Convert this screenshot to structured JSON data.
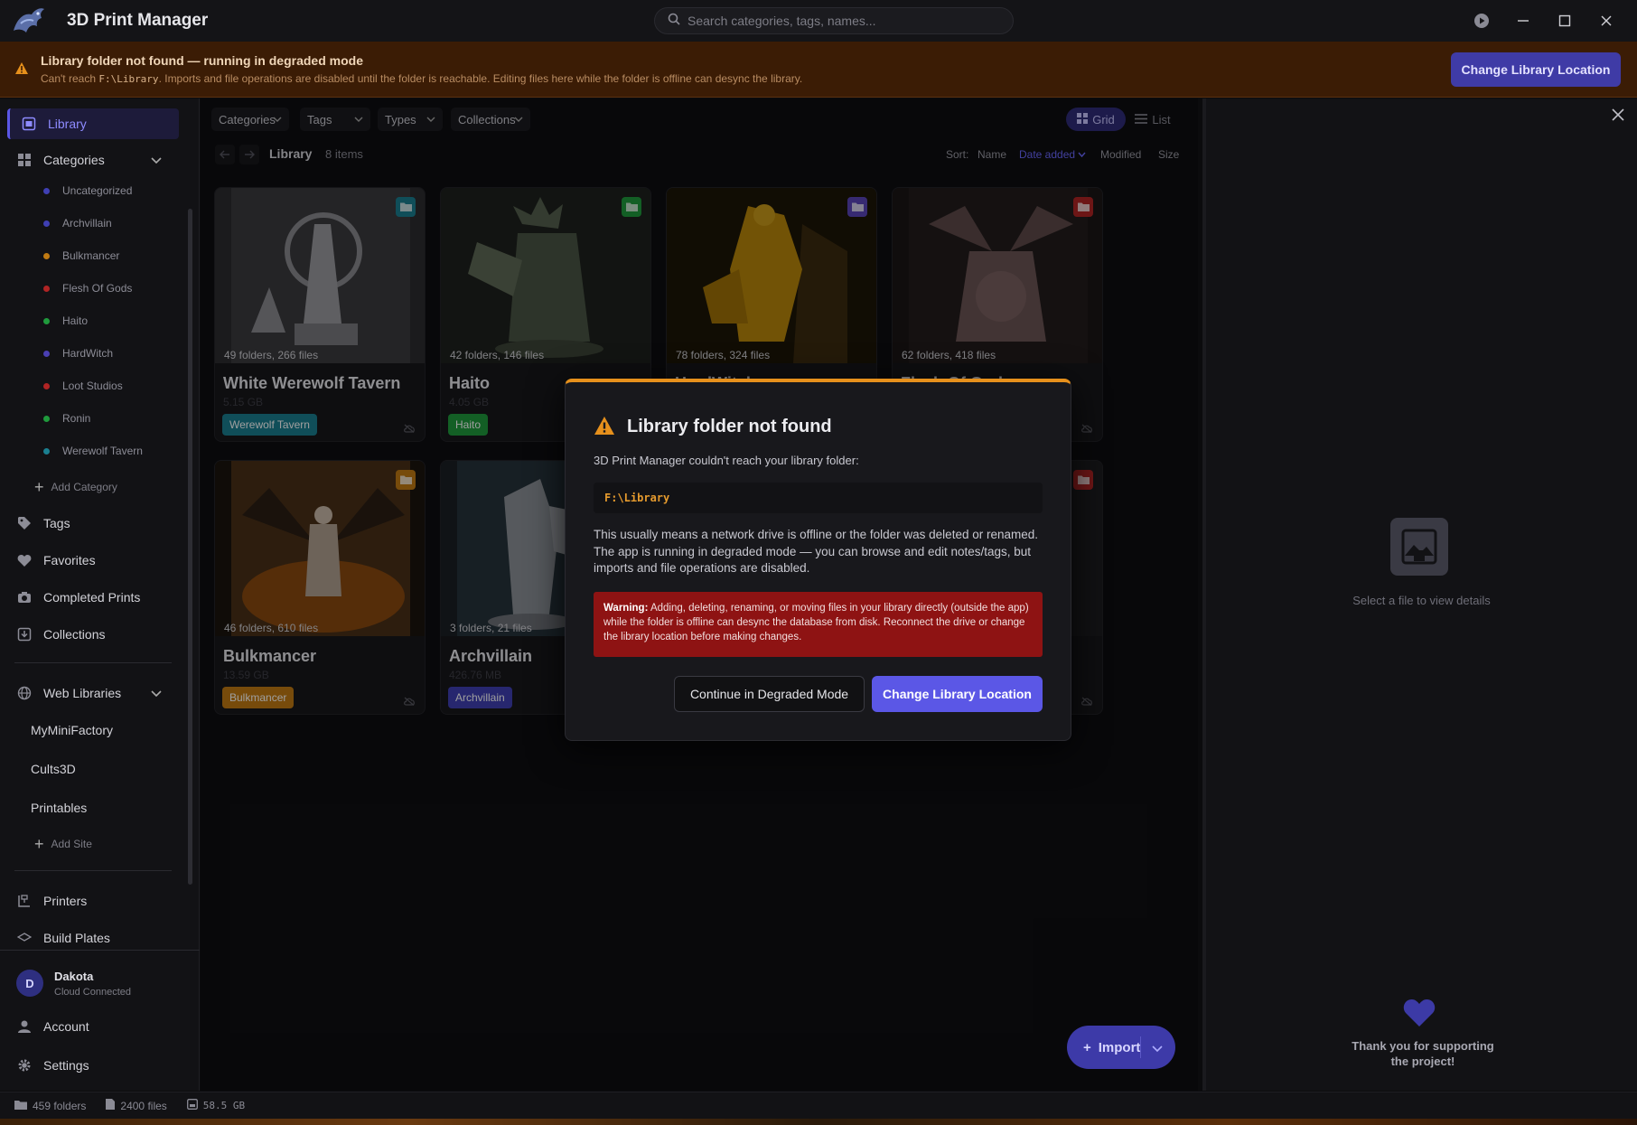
{
  "app": {
    "title": "3D Print Manager"
  },
  "search": {
    "placeholder": "Search categories, tags, names..."
  },
  "banner": {
    "title": "Library folder not found — running in degraded mode",
    "text_before": "Can't reach ",
    "path": "F:\\Library",
    "text_after": ". Imports and file operations are disabled until the folder is reachable. Editing files here while the folder is offline can desync the library.",
    "button": "Change Library Location"
  },
  "sidebar": {
    "library": "Library",
    "categories_label": "Categories",
    "categories": [
      {
        "label": "Uncategorized",
        "color": "#3f3fb3"
      },
      {
        "label": "Archvillain",
        "color": "#3f3fb3"
      },
      {
        "label": "Bulkmancer",
        "color": "#c07a12"
      },
      {
        "label": "Flesh Of Gods",
        "color": "#b02424"
      },
      {
        "label": "Haito",
        "color": "#1f9a3c"
      },
      {
        "label": "HardWitch",
        "color": "#4a3fb3"
      },
      {
        "label": "Loot Studios",
        "color": "#b02424"
      },
      {
        "label": "Ronin",
        "color": "#1f9a3c"
      },
      {
        "label": "Werewolf Tavern",
        "color": "#1a7f90"
      }
    ],
    "add_category": "Add Category",
    "tags": "Tags",
    "favorites": "Favorites",
    "completed_prints": "Completed Prints",
    "collections": "Collections",
    "web_libraries": "Web Libraries",
    "web_sites": [
      "MyMiniFactory",
      "Cults3D",
      "Printables"
    ],
    "add_site": "Add Site",
    "printers": "Printers",
    "build_plates": "Build Plates",
    "user": {
      "initial": "D",
      "name": "Dakota",
      "status": "Cloud Connected"
    },
    "account": "Account",
    "settings": "Settings"
  },
  "toolbar": {
    "filters": [
      "Categories",
      "Tags",
      "Types",
      "Collections"
    ],
    "grid": "Grid",
    "list": "List",
    "breadcrumb": "Library",
    "item_count": "8 items",
    "sort_label": "Sort:",
    "sort_options": [
      "Name",
      "Date added",
      "Modified",
      "Size"
    ],
    "sort_active": "Date added"
  },
  "cards": [
    {
      "title": "White Werewolf Tavern",
      "meta": "49 folders, 266 files",
      "size": "5.15 GB",
      "tag": "Werewolf Tavern",
      "tag_color": "#1a7f90",
      "badge_color": "#1a7f90"
    },
    {
      "title": "Haito",
      "meta": "42 folders, 146 files",
      "size": "4.05 GB",
      "tag": "Haito",
      "tag_color": "#1f9a3c",
      "badge_color": "#1f9a3c"
    },
    {
      "title": "HardWitch",
      "meta": "78 folders, 324 files",
      "size": "",
      "tag": "",
      "tag_color": "#4a3fb3",
      "badge_color": "#5a45b8"
    },
    {
      "title": "Flesh Of Gods",
      "meta": "62 folders, 418 files",
      "size": "",
      "tag": "",
      "tag_color": "#b02424",
      "badge_color": "#b02424"
    },
    {
      "title": "Bulkmancer",
      "meta": "46 folders, 610 files",
      "size": "13.59 GB",
      "tag": "Bulkmancer",
      "tag_color": "#c07a12",
      "badge_color": "#c07a12"
    },
    {
      "title": "Archvillain",
      "meta": "3 folders, 21 files",
      "size": "426.76 MB",
      "tag": "Archvillain",
      "tag_color": "#3f3fb3",
      "badge_color": "#3f3fb3"
    },
    {
      "title": "",
      "meta": "",
      "size": "",
      "tag": "",
      "tag_color": "#b02424",
      "badge_color": "#b02424"
    }
  ],
  "import": {
    "label": "Import"
  },
  "detail": {
    "empty": "Select a file to view details",
    "thanks": "Thank you for supporting the project!"
  },
  "status": {
    "folders": "459",
    "folders_label": "folders",
    "files": "2400",
    "files_label": "files",
    "size": "58.5 GB"
  },
  "modal": {
    "title": "Library folder not found",
    "intro": "3D Print Manager couldn't reach your library folder:",
    "path": "F:\\Library",
    "body": "This usually means a network drive is offline or the folder was deleted or renamed. The app is running in degraded mode — you can browse and edit notes/tags, but imports and file operations are disabled.",
    "warning_label": "Warning:",
    "warning_text": " Adding, deleting, renaming, or moving files in your library directly (outside the app) while the folder is offline can desync the database from disk. Reconnect the drive or change the library location before making changes.",
    "continue_button": "Continue in Degraded Mode",
    "change_button": "Change Library Location"
  },
  "colors": {
    "accent": "#5b57e6",
    "warning": "#e6901c",
    "danger": "#8e1313"
  }
}
